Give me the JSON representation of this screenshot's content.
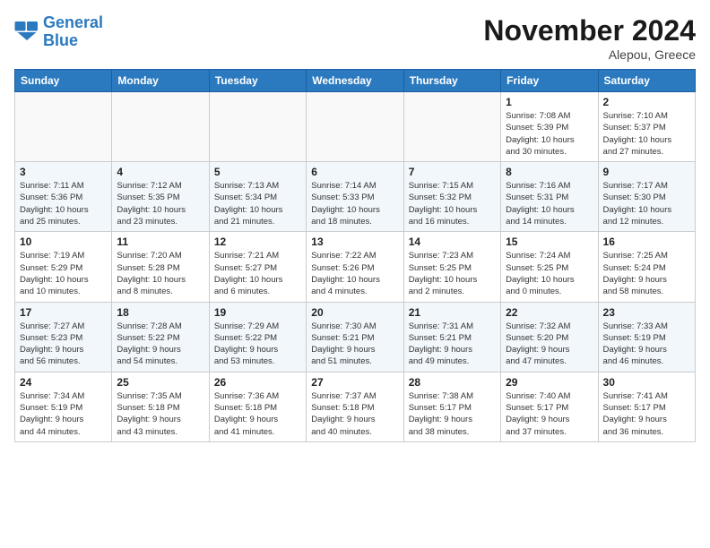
{
  "header": {
    "logo_line1": "General",
    "logo_line2": "Blue",
    "month": "November 2024",
    "location": "Alepou, Greece"
  },
  "weekdays": [
    "Sunday",
    "Monday",
    "Tuesday",
    "Wednesday",
    "Thursday",
    "Friday",
    "Saturday"
  ],
  "weeks": [
    [
      {
        "day": "",
        "info": ""
      },
      {
        "day": "",
        "info": ""
      },
      {
        "day": "",
        "info": ""
      },
      {
        "day": "",
        "info": ""
      },
      {
        "day": "",
        "info": ""
      },
      {
        "day": "1",
        "info": "Sunrise: 7:08 AM\nSunset: 5:39 PM\nDaylight: 10 hours\nand 30 minutes."
      },
      {
        "day": "2",
        "info": "Sunrise: 7:10 AM\nSunset: 5:37 PM\nDaylight: 10 hours\nand 27 minutes."
      }
    ],
    [
      {
        "day": "3",
        "info": "Sunrise: 7:11 AM\nSunset: 5:36 PM\nDaylight: 10 hours\nand 25 minutes."
      },
      {
        "day": "4",
        "info": "Sunrise: 7:12 AM\nSunset: 5:35 PM\nDaylight: 10 hours\nand 23 minutes."
      },
      {
        "day": "5",
        "info": "Sunrise: 7:13 AM\nSunset: 5:34 PM\nDaylight: 10 hours\nand 21 minutes."
      },
      {
        "day": "6",
        "info": "Sunrise: 7:14 AM\nSunset: 5:33 PM\nDaylight: 10 hours\nand 18 minutes."
      },
      {
        "day": "7",
        "info": "Sunrise: 7:15 AM\nSunset: 5:32 PM\nDaylight: 10 hours\nand 16 minutes."
      },
      {
        "day": "8",
        "info": "Sunrise: 7:16 AM\nSunset: 5:31 PM\nDaylight: 10 hours\nand 14 minutes."
      },
      {
        "day": "9",
        "info": "Sunrise: 7:17 AM\nSunset: 5:30 PM\nDaylight: 10 hours\nand 12 minutes."
      }
    ],
    [
      {
        "day": "10",
        "info": "Sunrise: 7:19 AM\nSunset: 5:29 PM\nDaylight: 10 hours\nand 10 minutes."
      },
      {
        "day": "11",
        "info": "Sunrise: 7:20 AM\nSunset: 5:28 PM\nDaylight: 10 hours\nand 8 minutes."
      },
      {
        "day": "12",
        "info": "Sunrise: 7:21 AM\nSunset: 5:27 PM\nDaylight: 10 hours\nand 6 minutes."
      },
      {
        "day": "13",
        "info": "Sunrise: 7:22 AM\nSunset: 5:26 PM\nDaylight: 10 hours\nand 4 minutes."
      },
      {
        "day": "14",
        "info": "Sunrise: 7:23 AM\nSunset: 5:25 PM\nDaylight: 10 hours\nand 2 minutes."
      },
      {
        "day": "15",
        "info": "Sunrise: 7:24 AM\nSunset: 5:25 PM\nDaylight: 10 hours\nand 0 minutes."
      },
      {
        "day": "16",
        "info": "Sunrise: 7:25 AM\nSunset: 5:24 PM\nDaylight: 9 hours\nand 58 minutes."
      }
    ],
    [
      {
        "day": "17",
        "info": "Sunrise: 7:27 AM\nSunset: 5:23 PM\nDaylight: 9 hours\nand 56 minutes."
      },
      {
        "day": "18",
        "info": "Sunrise: 7:28 AM\nSunset: 5:22 PM\nDaylight: 9 hours\nand 54 minutes."
      },
      {
        "day": "19",
        "info": "Sunrise: 7:29 AM\nSunset: 5:22 PM\nDaylight: 9 hours\nand 53 minutes."
      },
      {
        "day": "20",
        "info": "Sunrise: 7:30 AM\nSunset: 5:21 PM\nDaylight: 9 hours\nand 51 minutes."
      },
      {
        "day": "21",
        "info": "Sunrise: 7:31 AM\nSunset: 5:21 PM\nDaylight: 9 hours\nand 49 minutes."
      },
      {
        "day": "22",
        "info": "Sunrise: 7:32 AM\nSunset: 5:20 PM\nDaylight: 9 hours\nand 47 minutes."
      },
      {
        "day": "23",
        "info": "Sunrise: 7:33 AM\nSunset: 5:19 PM\nDaylight: 9 hours\nand 46 minutes."
      }
    ],
    [
      {
        "day": "24",
        "info": "Sunrise: 7:34 AM\nSunset: 5:19 PM\nDaylight: 9 hours\nand 44 minutes."
      },
      {
        "day": "25",
        "info": "Sunrise: 7:35 AM\nSunset: 5:18 PM\nDaylight: 9 hours\nand 43 minutes."
      },
      {
        "day": "26",
        "info": "Sunrise: 7:36 AM\nSunset: 5:18 PM\nDaylight: 9 hours\nand 41 minutes."
      },
      {
        "day": "27",
        "info": "Sunrise: 7:37 AM\nSunset: 5:18 PM\nDaylight: 9 hours\nand 40 minutes."
      },
      {
        "day": "28",
        "info": "Sunrise: 7:38 AM\nSunset: 5:17 PM\nDaylight: 9 hours\nand 38 minutes."
      },
      {
        "day": "29",
        "info": "Sunrise: 7:40 AM\nSunset: 5:17 PM\nDaylight: 9 hours\nand 37 minutes."
      },
      {
        "day": "30",
        "info": "Sunrise: 7:41 AM\nSunset: 5:17 PM\nDaylight: 9 hours\nand 36 minutes."
      }
    ]
  ]
}
